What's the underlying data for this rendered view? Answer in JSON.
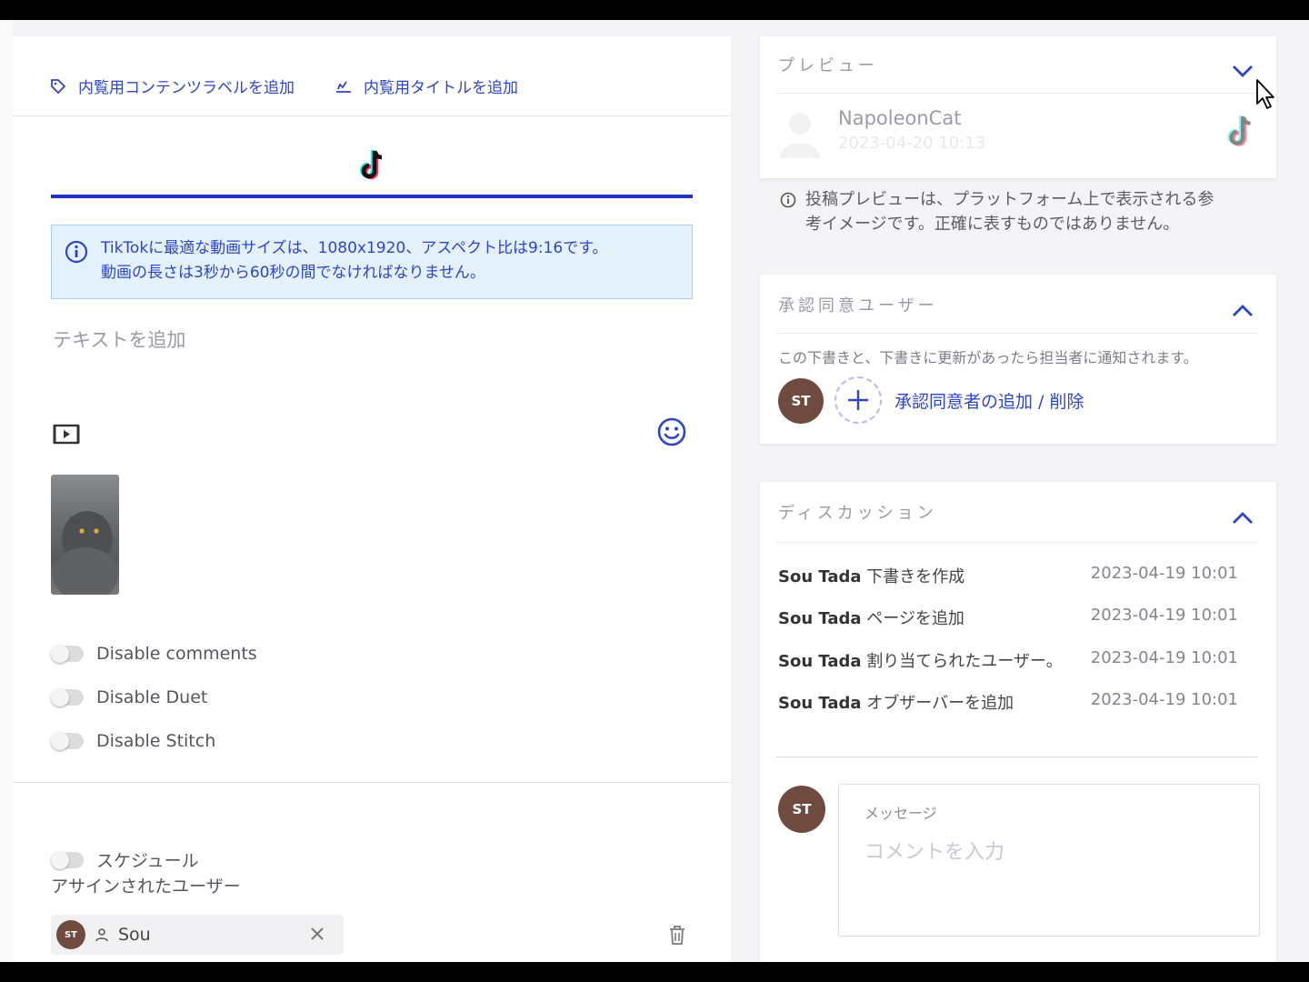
{
  "left": {
    "toplinks": {
      "content_label": "内覧用コンテンツラベルを追加",
      "title_label": "内覧用タイトルを追加"
    },
    "info": {
      "line1": "TikTokに最適な動画サイズは、1080x1920、アスペクト比は9:16です。",
      "line2": "動画の長さは3秒から60秒の間でなければなりません。"
    },
    "text_placeholder": "テキストを追加",
    "toggles": {
      "comments": "Disable comments",
      "duet": "Disable Duet",
      "stitch": "Disable Stitch",
      "schedule": "スケジュール"
    },
    "assigned_label": "アサインされたユーザー",
    "assigned_user": {
      "initials": "ST",
      "name": "Sou"
    }
  },
  "preview": {
    "title": "プレビュー",
    "account_name": "NapoleonCat",
    "date": "2023-04-20 10:13",
    "disclaimer_line1": "投稿プレビューは、プラットフォーム上で表示される参",
    "disclaimer_line2": "考イメージです。正確に表すものではありません。"
  },
  "approvers": {
    "title": "承認同意ユーザー",
    "description": "この下書きと、下書きに更新があったら担当者に通知されます。",
    "initials": "ST",
    "link": "承認同意者の追加 / 削除"
  },
  "discussion": {
    "title": "ディスカッション",
    "rows": [
      {
        "who": "Sou Tada",
        "action": "下書きを作成",
        "when": "2023-04-19 10:01"
      },
      {
        "who": "Sou Tada",
        "action": "ページを追加",
        "when": "2023-04-19 10:01"
      },
      {
        "who": "Sou Tada",
        "action": "割り当てられたユーザー。",
        "when": "2023-04-19 10:01"
      },
      {
        "who": "Sou Tada",
        "action": "オブザーバーを追加",
        "when": "2023-04-19 10:01"
      }
    ],
    "initials": "ST",
    "message_label": "メッセージ",
    "message_placeholder": "コメントを入力"
  },
  "colors": {
    "accent": "#2e45c7",
    "avatar": "#6e4a3f",
    "info_bg": "#e4f1fb"
  }
}
